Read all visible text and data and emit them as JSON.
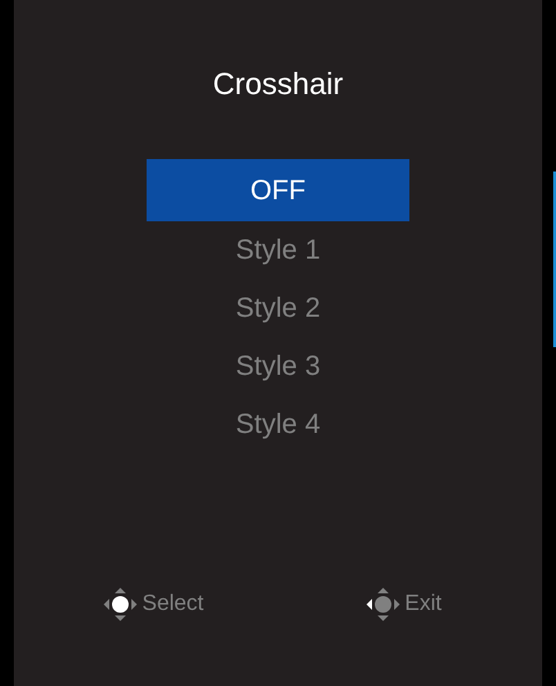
{
  "title": "Crosshair",
  "options": [
    {
      "label": "OFF",
      "selected": true
    },
    {
      "label": "Style 1",
      "selected": false
    },
    {
      "label": "Style 2",
      "selected": false
    },
    {
      "label": "Style 3",
      "selected": false
    },
    {
      "label": "Style 4",
      "selected": false
    }
  ],
  "hints": [
    {
      "label": "Select",
      "kind": "press"
    },
    {
      "label": "Exit",
      "kind": "left"
    }
  ]
}
